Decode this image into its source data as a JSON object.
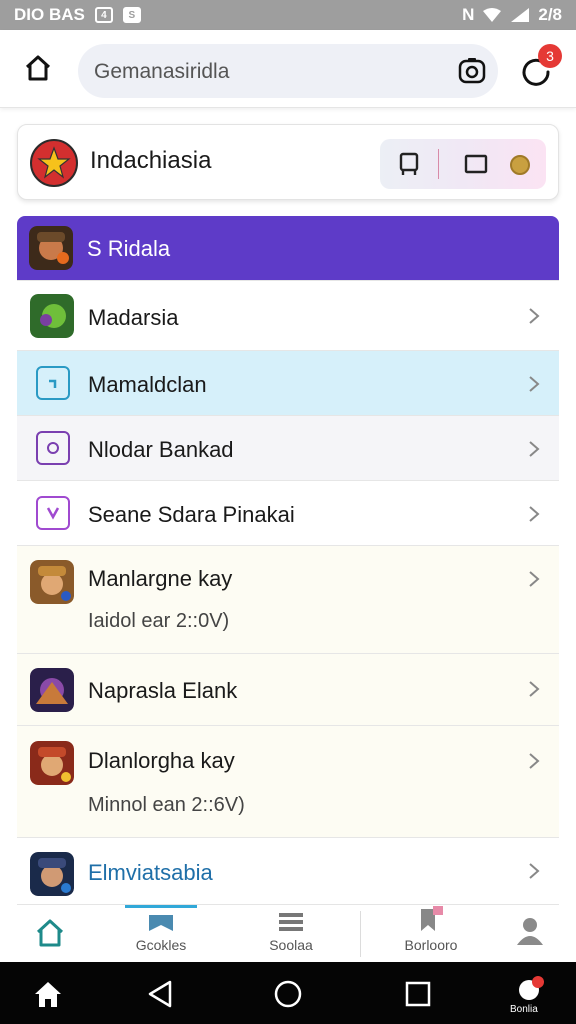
{
  "status_bar": {
    "left_text": "DIO BAS",
    "time": "2/8"
  },
  "app_bar": {
    "search_text": "Gemanasiridla",
    "notification_count": "3"
  },
  "header_card": {
    "title": "Indachiasia"
  },
  "menu": {
    "highlight_label": "S Ridala",
    "items": [
      {
        "label": "Madarsia"
      },
      {
        "label": "Mamaldclan"
      },
      {
        "label": "Nlodar Bankad"
      },
      {
        "label": "Seane Sdara Pinakai"
      },
      {
        "label": "Manlargne kay",
        "sub": "Iaidol ear 2::0V)"
      },
      {
        "label": "Naprasla Elank"
      },
      {
        "label": "Dlanlorgha kay",
        "sub": "Minnol ean 2::6V)"
      },
      {
        "label": "Elmviatsabia"
      }
    ]
  },
  "tabs": [
    {
      "label": ""
    },
    {
      "label": "Gcokles"
    },
    {
      "label": "Soolaa"
    },
    {
      "label": "Borlooro"
    },
    {
      "label": ""
    }
  ],
  "nav": {
    "recents_label": "Bonlia"
  },
  "colors": {
    "highlight": "#5e3bc8",
    "selected_row": "#d6f0fa",
    "accent": "#31a8d8",
    "badge": "#e53935"
  }
}
